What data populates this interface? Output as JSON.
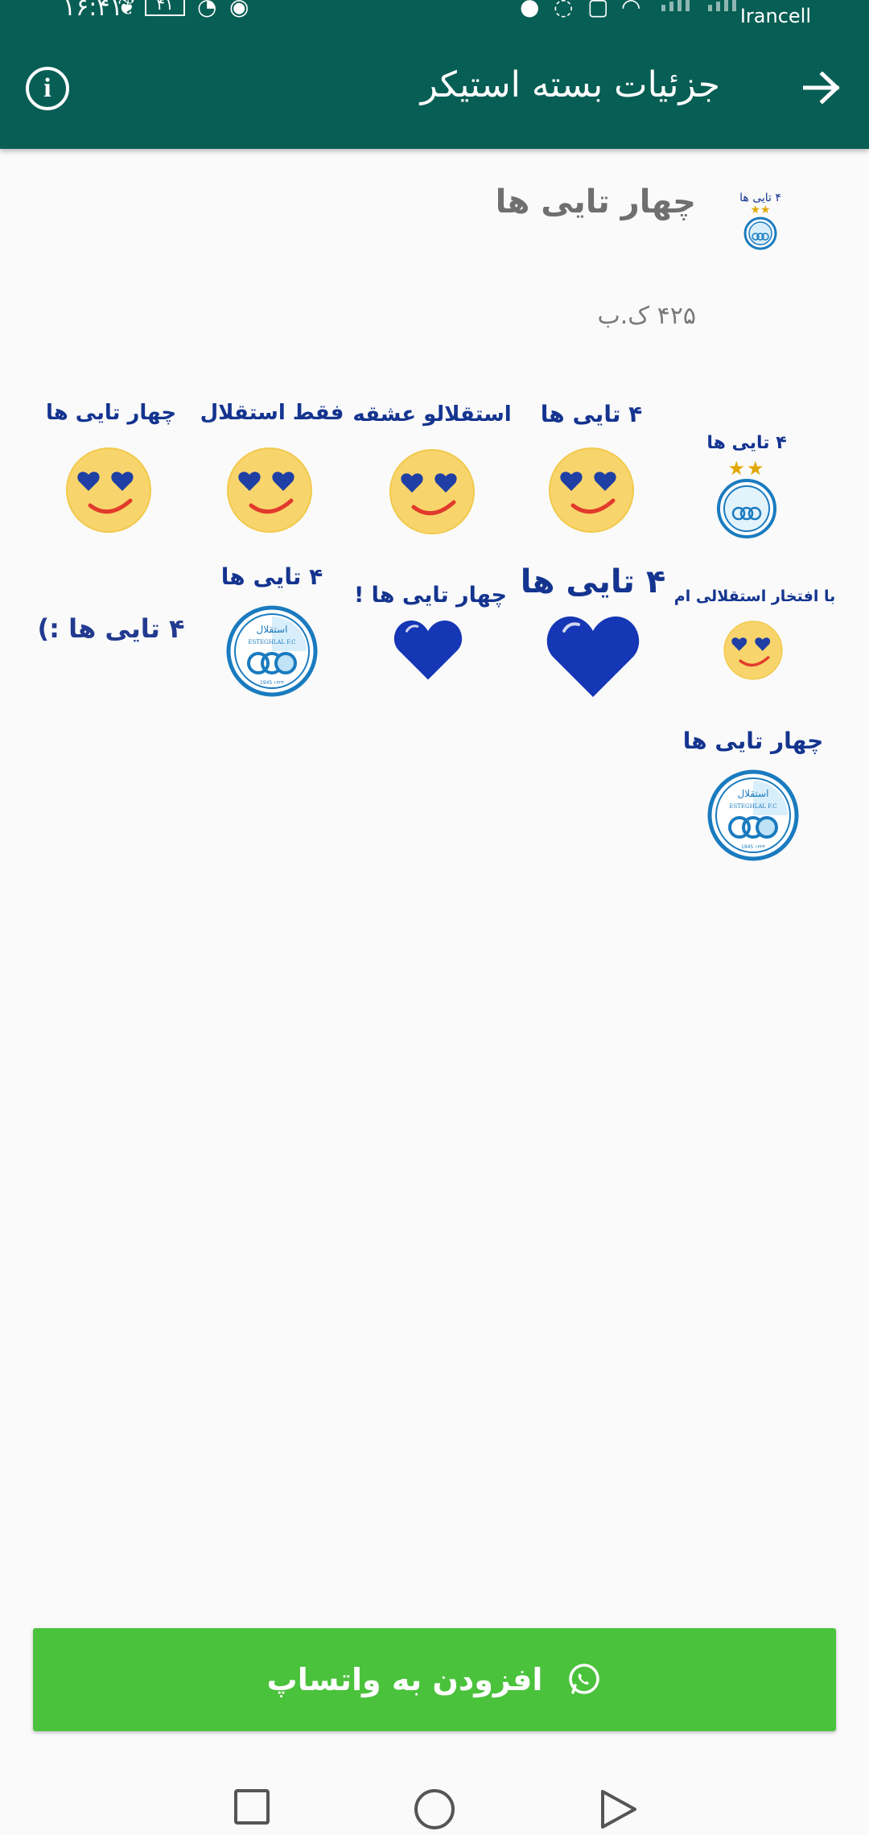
{
  "statusbar": {
    "time": "۱۶:۴۱",
    "battery": "۴۱",
    "carrier": "Irancell"
  },
  "header": {
    "title": "جزئیات بسته استیکر"
  },
  "pack": {
    "name": "چهار تایی ها",
    "size": "۴۲۵ ک.ب",
    "tray_caption": "۴ تایی ها"
  },
  "stickers": [
    {
      "caption": "۴ تایی ها",
      "kind": "logo-stars"
    },
    {
      "caption": "۴ تایی ها",
      "kind": "smiley"
    },
    {
      "caption": "استقلالو عشقه",
      "kind": "smiley"
    },
    {
      "caption": "فقط استقلال",
      "kind": "smiley"
    },
    {
      "caption": "چهار تایی ها",
      "kind": "smiley"
    },
    {
      "caption": "با افتخار استقلالی ام",
      "kind": "smiley"
    },
    {
      "caption": "۴ تایی ها",
      "kind": "heart"
    },
    {
      "caption": "چهار تایی ها !",
      "kind": "heart"
    },
    {
      "caption": "۴ تایی ها",
      "kind": "logo"
    },
    {
      "caption": "۴ تایی ها :)",
      "kind": "text"
    },
    {
      "caption": "چهار تایی ها",
      "kind": "logo"
    }
  ],
  "logo_text": {
    "name_fa": "استقلال",
    "name_en": "ESTEGHLAL F.C",
    "years": "1945   ۱۳۲۴"
  },
  "actions": {
    "add_to_whatsapp": "افزودن به واتساپ"
  },
  "colors": {
    "appbar": "#075e54",
    "button": "#4ac23b",
    "brand_blue": "#14348f"
  },
  "icons": [
    "back-arrow-icon",
    "info-icon",
    "whatsapp-icon",
    "smiley-icon",
    "heart-icon",
    "esteghlal-logo-icon"
  ]
}
